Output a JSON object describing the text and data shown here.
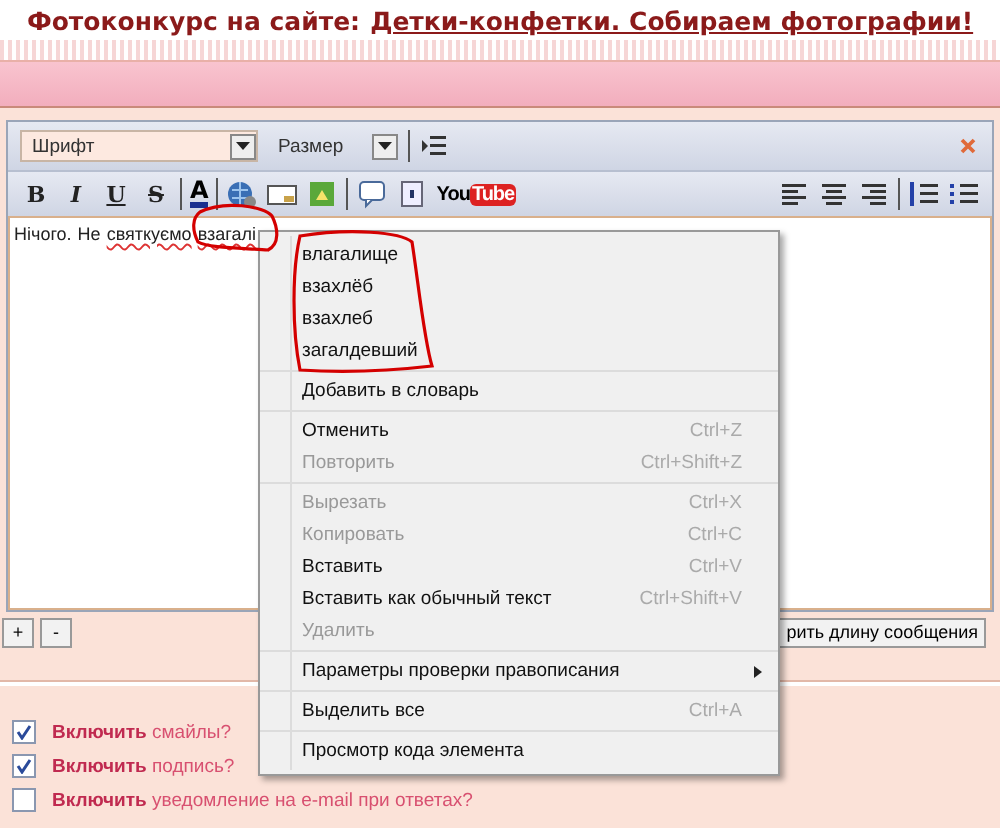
{
  "headline": {
    "prefix": "Фотоконкурс на сайте:",
    "link": "Детки-конфетки. Собираем фотографии!"
  },
  "editor": {
    "font_select": {
      "placeholder": "Шрифт"
    },
    "size_select": {
      "placeholder": "Размер"
    },
    "youtube": {
      "you": "You",
      "tube": "Tube"
    },
    "format_buttons": [
      {
        "label": "B",
        "kind": "bold"
      },
      {
        "label": "I",
        "kind": "italic"
      },
      {
        "label": "U",
        "kind": "underline"
      },
      {
        "label": "S",
        "kind": "strike"
      }
    ],
    "color_button": {
      "label": "A"
    },
    "text": [
      {
        "word": "Нічого.",
        "misspelled": false
      },
      {
        "word": "Не",
        "misspelled": false
      },
      {
        "word": "святкуємо",
        "misspelled": true
      },
      {
        "word": "взагалі",
        "misspelled": true
      }
    ],
    "resize_buttons": [
      "+",
      "-"
    ],
    "check_length_button": "рить длину сообщения"
  },
  "context_menu": {
    "sections": [
      [
        {
          "label": "влагалище",
          "kind": "suggestion"
        },
        {
          "label": "взахлёб",
          "kind": "suggestion"
        },
        {
          "label": "взахлеб",
          "kind": "suggestion"
        },
        {
          "label": "загалдевший",
          "kind": "suggestion"
        }
      ],
      [
        {
          "label": "Добавить в словарь",
          "kind": "item",
          "disabled": false
        }
      ],
      [
        {
          "label": "Отменить",
          "kind": "item",
          "shortcut": "Ctrl+Z",
          "disabled": false
        },
        {
          "label": "Повторить",
          "kind": "item",
          "shortcut": "Ctrl+Shift+Z",
          "disabled": true
        }
      ],
      [
        {
          "label": "Вырезать",
          "kind": "item",
          "shortcut": "Ctrl+X",
          "disabled": true
        },
        {
          "label": "Копировать",
          "kind": "item",
          "shortcut": "Ctrl+C",
          "disabled": true
        },
        {
          "label": "Вставить",
          "kind": "item",
          "shortcut": "Ctrl+V",
          "disabled": false
        },
        {
          "label": "Вставить как обычный текст",
          "kind": "item",
          "shortcut": "Ctrl+Shift+V",
          "disabled": false
        },
        {
          "label": "Удалить",
          "kind": "item",
          "disabled": true
        }
      ],
      [
        {
          "label": "Параметры проверки правописания",
          "kind": "submenu",
          "disabled": false
        }
      ],
      [
        {
          "label": "Выделить все",
          "kind": "item",
          "shortcut": "Ctrl+A",
          "disabled": false
        }
      ],
      [
        {
          "label": "Просмотр кода элемента",
          "kind": "item",
          "disabled": false
        }
      ]
    ]
  },
  "options": [
    {
      "bold": "Включить",
      "rest": "смайлы?",
      "checked": true
    },
    {
      "bold": "Включить",
      "rest": "подпись?",
      "checked": true
    },
    {
      "bold": "Включить",
      "rest": "уведомление на e-mail при ответах?",
      "checked": false
    }
  ]
}
